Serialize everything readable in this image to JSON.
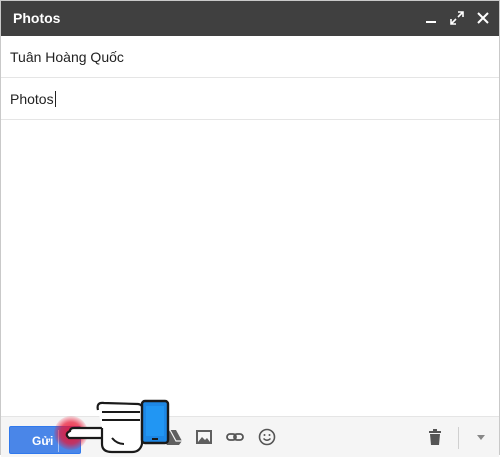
{
  "window": {
    "title": "Photos"
  },
  "compose": {
    "to_value": "Tuân Hoàng Quốc",
    "subject_value": "Photos"
  },
  "toolbar": {
    "send_label": "Gửi"
  },
  "colors": {
    "titlebar": "#404040",
    "send_button": "#4a86e8",
    "toolbar_bg": "#f5f5f5",
    "tap_highlight": "#eb1432",
    "phone_screen": "#1e88e5"
  },
  "icons": {
    "window_controls": [
      "minimize-icon",
      "expand-icon",
      "close-icon"
    ],
    "toolbar": [
      "attach-icon",
      "drive-icon",
      "photo-icon",
      "link-icon",
      "emoji-icon",
      "trash-icon",
      "more-options-icon"
    ],
    "overlay": [
      "pointing-hand-icon",
      "phone-icon"
    ]
  }
}
